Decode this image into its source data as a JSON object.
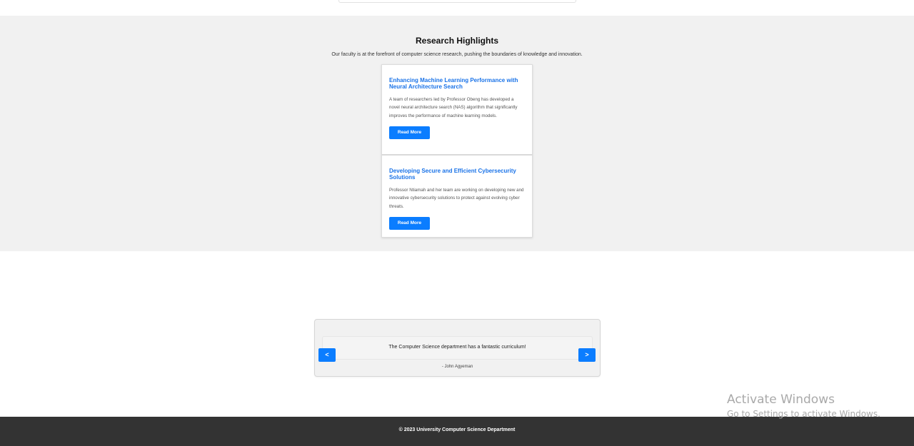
{
  "research": {
    "title": "Research Highlights",
    "subtitle": "Our faculty is at the forefront of computer science research, pushing the boundaries of knowledge and innovation.",
    "cards": [
      {
        "title": "Enhancing Machine Learning Performance with Neural Architecture Search",
        "body": "A team of researchers led by Professor Obeng has developed a novel neural architecture search (NAS) algorithm that significantly improves the performance of machine learning models.",
        "button": "Read More"
      },
      {
        "title": "Developing Secure and Efficient Cybersecurity Solutions",
        "body": "Professor Ntiamah and her team are working on developing new and innovative cybersecurity solutions to protect against evolving cyber threats.",
        "button": "Read More"
      }
    ]
  },
  "testimonial": {
    "quote": "The Computer Science department has a fantastic curriculum!",
    "author": "- John Agyeman",
    "prev_label": "<",
    "next_label": ">"
  },
  "watermark": {
    "line1": "Activate Windows",
    "line2": "Go to Settings to activate Windows."
  },
  "footer": {
    "text": "© 2023 University Computer Science Department"
  },
  "colors": {
    "accent": "#0b7dff",
    "link": "#1a73e8",
    "section_bg": "#f1f1f1",
    "footer_bg": "#333333"
  }
}
